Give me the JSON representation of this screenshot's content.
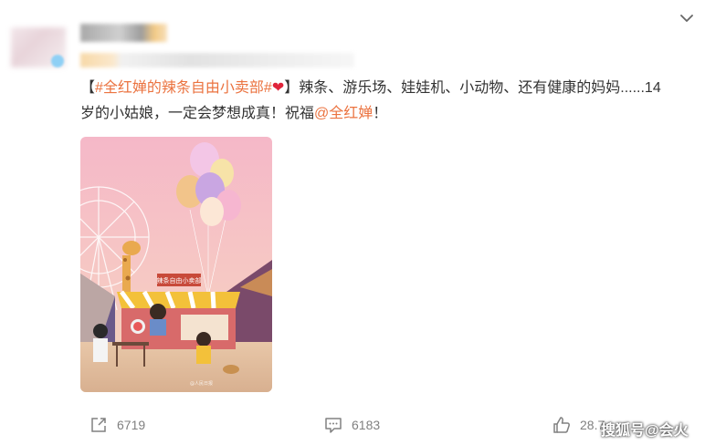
{
  "post": {
    "topic": "#全红婵的辣条自由小卖部#",
    "bracket_open": "【",
    "bracket_close": "】",
    "heart": "❤",
    "body": "辣条、游乐场、娃娃机、小动物、还有健康的妈妈......14岁的小姑娘，一定会梦想成真！祝福",
    "mention": "@全红婵",
    "end": "！",
    "image_sign": "辣条自由小卖部",
    "image_watermark": "@人民日报"
  },
  "actions": {
    "repost_count": "6719",
    "comment_count": "6183",
    "like_count": "28.7"
  },
  "watermark": "搜狐号@会火",
  "icons": {
    "menu": "chevron-down-icon",
    "repost": "share-icon",
    "comment": "comment-icon",
    "like": "thumbs-up-icon"
  },
  "colors": {
    "accent": "#eb7340",
    "heart": "#e0243a",
    "text": "#333333",
    "muted": "#808080"
  }
}
